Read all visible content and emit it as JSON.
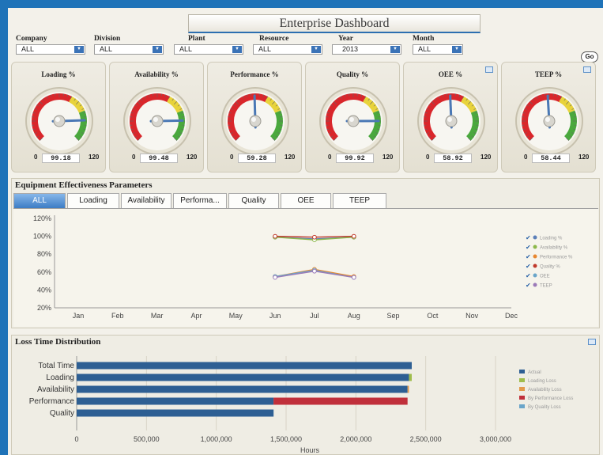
{
  "dashboard": {
    "title": "Enterprise Dashboard"
  },
  "filters": [
    {
      "label": "Company",
      "value": "ALL"
    },
    {
      "label": "Division",
      "value": "ALL"
    },
    {
      "label": "Plant",
      "value": "ALL"
    },
    {
      "label": "Resource",
      "value": "ALL"
    },
    {
      "label": "Year",
      "value": "2013"
    },
    {
      "label": "Month",
      "value": "ALL"
    }
  ],
  "go_label": "Go",
  "gauges": [
    {
      "title": "Loading %",
      "value": 99.18,
      "display": "99.18",
      "min": "0",
      "max": "120",
      "has_icon": false
    },
    {
      "title": "Availability %",
      "value": 99.48,
      "display": "99.48",
      "min": "0",
      "max": "120",
      "has_icon": false
    },
    {
      "title": "Performance %",
      "value": 59.28,
      "display": "59.28",
      "min": "0",
      "max": "120",
      "has_icon": false
    },
    {
      "title": "Quality %",
      "value": 99.92,
      "display": "99.92",
      "min": "0",
      "max": "120",
      "has_icon": false
    },
    {
      "title": "OEE %",
      "value": 58.92,
      "display": "58.92",
      "min": "0",
      "max": "120",
      "has_icon": true
    },
    {
      "title": "TEEP %",
      "value": 58.44,
      "display": "58.44",
      "min": "0",
      "max": "120",
      "has_icon": true
    }
  ],
  "gauge_colors": {
    "red": "#d9262b",
    "yellow": "#e8d33b",
    "green": "#4aa83d",
    "needle": "#4a78b5"
  },
  "eep": {
    "title": "Equipment Effectiveness Parameters",
    "tabs": [
      "ALL",
      "Loading",
      "Availability",
      "Performa...",
      "Quality",
      "OEE",
      "TEEP"
    ],
    "active_tab": 0
  },
  "loss": {
    "title": "Loss Time Distribution"
  },
  "chart_data": [
    {
      "type": "line",
      "title": "",
      "xlabel": "",
      "ylabel": "",
      "categories": [
        "Jan",
        "Feb",
        "Mar",
        "Apr",
        "May",
        "Jun",
        "Jul",
        "Aug",
        "Sep",
        "Oct",
        "Nov",
        "Dec"
      ],
      "y_ticks": [
        "120%",
        "100%",
        "80%",
        "60%",
        "40%",
        "20%"
      ],
      "ylim": [
        20,
        120
      ],
      "legend_position": "right",
      "grid": false,
      "series": [
        {
          "name": "Loading %",
          "color": "#5b7fb8",
          "values": [
            null,
            null,
            null,
            null,
            null,
            99,
            97,
            99,
            null,
            null,
            null,
            null
          ]
        },
        {
          "name": "Availability %",
          "color": "#8cb84a",
          "values": [
            null,
            null,
            null,
            null,
            null,
            99,
            96,
            99,
            null,
            null,
            null,
            null
          ]
        },
        {
          "name": "Performance %",
          "color": "#e8872f",
          "values": [
            null,
            null,
            null,
            null,
            null,
            55,
            63,
            55,
            null,
            null,
            null,
            null
          ]
        },
        {
          "name": "Quality %",
          "color": "#c0392b",
          "values": [
            null,
            null,
            null,
            null,
            null,
            100,
            99,
            100,
            null,
            null,
            null,
            null
          ]
        },
        {
          "name": "OEE",
          "color": "#6aa5c9",
          "values": [
            null,
            null,
            null,
            null,
            null,
            55,
            62,
            54,
            null,
            null,
            null,
            null
          ]
        },
        {
          "name": "TEEP",
          "color": "#9b7ab8",
          "values": [
            null,
            null,
            null,
            null,
            null,
            54,
            61,
            54,
            null,
            null,
            null,
            null
          ]
        }
      ]
    },
    {
      "type": "bar",
      "orientation": "horizontal",
      "stacked": true,
      "title": "",
      "xlabel": "Hours",
      "ylabel": "",
      "categories": [
        "Total Time",
        "Loading",
        "Availability",
        "Performance",
        "Quality"
      ],
      "x_ticks": [
        "0",
        "500,000",
        "1,000,000",
        "1,500,000",
        "2,000,000",
        "2,500,000",
        "3,000,000"
      ],
      "xlim": [
        0,
        3000000
      ],
      "legend_position": "right",
      "grid": true,
      "series": [
        {
          "name": "Actual",
          "color": "#2e5f93",
          "values": [
            2400000,
            2380000,
            2370000,
            1410000,
            1410000
          ]
        },
        {
          "name": "Loading Loss",
          "color": "#9fbd4c",
          "values": [
            0,
            20000,
            0,
            0,
            0
          ]
        },
        {
          "name": "Availability Loss",
          "color": "#e39a4a",
          "values": [
            0,
            0,
            10000,
            0,
            0
          ]
        },
        {
          "name": "By Performance Loss",
          "color": "#c0303b",
          "values": [
            0,
            0,
            0,
            960000,
            0
          ]
        },
        {
          "name": "By Quality Loss",
          "color": "#6aa5c9",
          "values": [
            0,
            0,
            0,
            0,
            1000
          ]
        }
      ]
    }
  ]
}
